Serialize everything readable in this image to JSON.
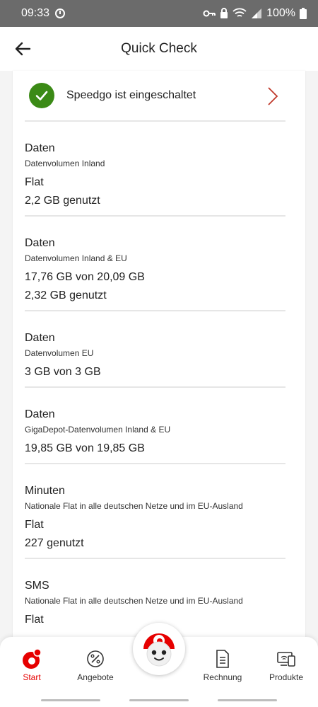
{
  "status": {
    "time": "09:33",
    "battery": "100%"
  },
  "header": {
    "title": "Quick Check"
  },
  "speedgo": {
    "label": "Speedgo ist eingeschaltet"
  },
  "items": [
    {
      "title": "Daten",
      "subtitle": "Datenvolumen Inland",
      "line1": "Flat",
      "line2": "2,2 GB genutzt"
    },
    {
      "title": "Daten",
      "subtitle": "Datenvolumen Inland & EU",
      "line1": "17,76 GB von 20,09 GB",
      "line2": "2,32 GB genutzt"
    },
    {
      "title": "Daten",
      "subtitle": "Datenvolumen EU",
      "line1": "3 GB von 3 GB"
    },
    {
      "title": "Daten",
      "subtitle": "GigaDepot-Datenvolumen Inland & EU",
      "line1": "19,85 GB von 19,85 GB"
    },
    {
      "title": "Minuten",
      "subtitle": "Nationale Flat in alle deutschen Netze und im EU-Ausland",
      "line1": "Flat",
      "line2": "227 genutzt"
    },
    {
      "title": "SMS",
      "subtitle": "Nationale Flat in alle deutschen Netze und im EU-Ausland",
      "line1": "Flat"
    }
  ],
  "nav": {
    "start": "Start",
    "angebote": "Angebote",
    "rechnung": "Rechnung",
    "produkte": "Produkte"
  },
  "colors": {
    "brand": "#e60000",
    "success": "#3b8a16"
  },
  "icons": [
    "alarm-icon",
    "key-icon",
    "wifi-icon",
    "signal-icon",
    "battery-icon",
    "back-arrow-icon",
    "check-icon",
    "chevron-right-icon",
    "vodafone-icon",
    "percent-icon",
    "document-icon",
    "devices-icon",
    "tobi-icon"
  ]
}
